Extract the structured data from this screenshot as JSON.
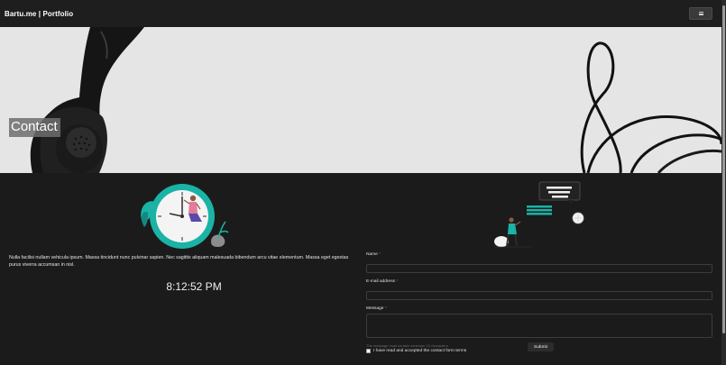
{
  "navbar": {
    "brand": "Bartu.me | Portfolio",
    "toggle_icon": "hamburger-menu-icon"
  },
  "hero": {
    "title": "Contact"
  },
  "content": {
    "description": "Nulla facilisi nullam vehicula ipsum. Massa tincidunt nunc pulvinar sapien. Nec sagittis aliquam malesuada bibendum arcu vitae elementum. Massa eget egestas purus viverra accumsan in nisl.",
    "clock": "8:12:52 PM"
  },
  "form": {
    "name_label": "Name",
    "email_label": "E-mail address",
    "message_label": "Message",
    "required_mark": "*",
    "message_hint": "The message must contain minimum 15 characters",
    "terms_label": "I have read and accepted the contact form terms",
    "submit_label": "Submit"
  },
  "colors": {
    "accent": "#1ab3a6",
    "background": "#1b1b1b",
    "navbar": "#1e1e1e"
  }
}
